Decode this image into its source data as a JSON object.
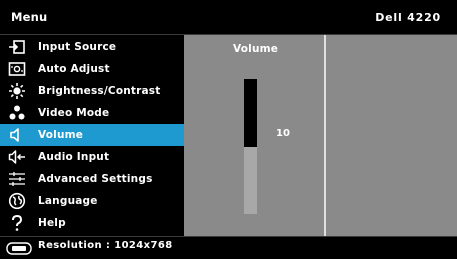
{
  "header": {
    "title": "Menu",
    "model": "Dell 4220"
  },
  "menu": {
    "items": [
      {
        "label": "Input Source",
        "icon": "input-source-icon",
        "active": false
      },
      {
        "label": "Auto Adjust",
        "icon": "auto-adjust-icon",
        "active": false
      },
      {
        "label": "Brightness/Contrast",
        "icon": "brightness-icon",
        "active": false
      },
      {
        "label": "Video Mode",
        "icon": "video-mode-icon",
        "active": false
      },
      {
        "label": "Volume",
        "icon": "speaker-icon",
        "active": true
      },
      {
        "label": "Audio Input",
        "icon": "audio-input-icon",
        "active": false
      },
      {
        "label": "Advanced Settings",
        "icon": "sliders-icon",
        "active": false
      },
      {
        "label": "Language",
        "icon": "globe-icon",
        "active": false
      },
      {
        "label": "Help",
        "icon": "help-icon",
        "active": false
      }
    ]
  },
  "panel": {
    "title": "Volume",
    "value": "10",
    "level_fraction": 0.5
  },
  "footer": {
    "resolution": "Resolution : 1024x768"
  },
  "colors": {
    "accent": "#1f9ad0",
    "panel": "#8a8a8a",
    "background": "#000000"
  }
}
